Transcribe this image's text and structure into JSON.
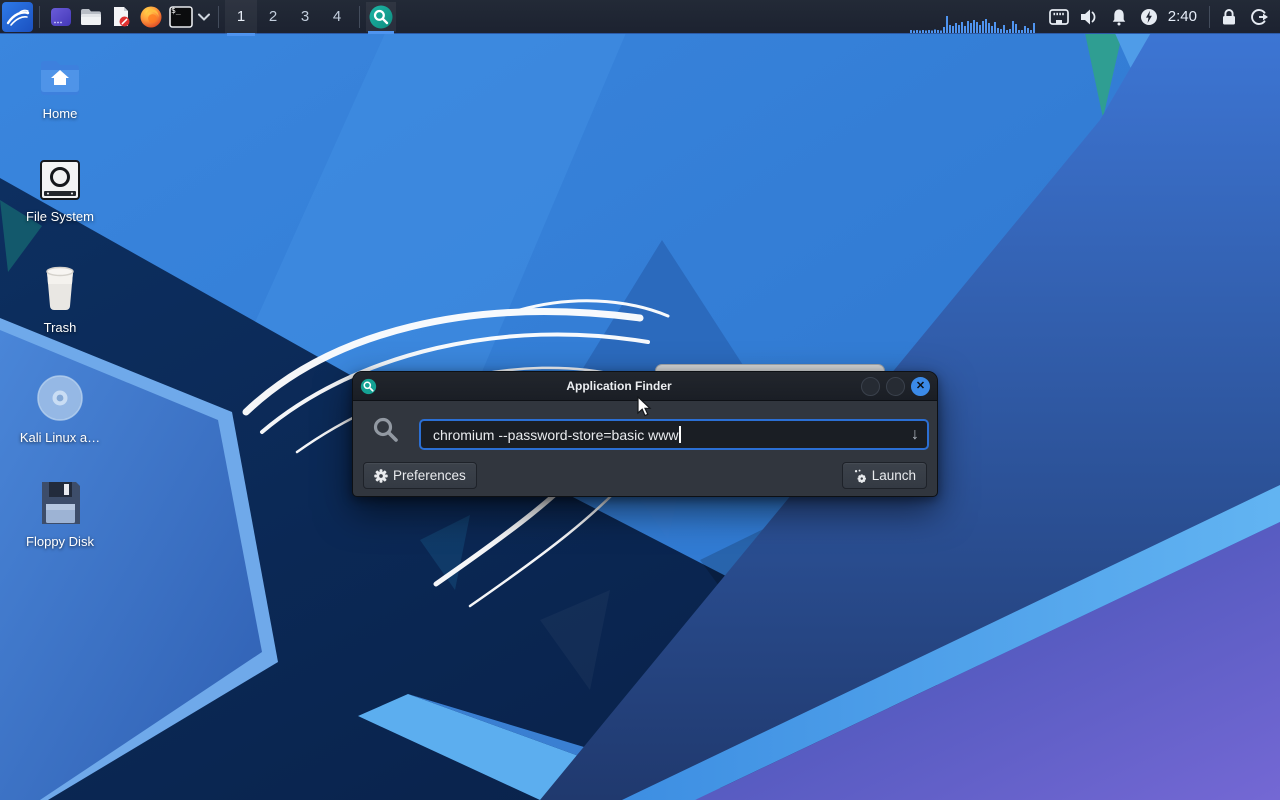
{
  "panel": {
    "workspaces": [
      "1",
      "2",
      "3",
      "4"
    ],
    "clock": "2:40",
    "terminal_glyph": "$_"
  },
  "desktop": {
    "icons": [
      {
        "label": "Home"
      },
      {
        "label": "File System"
      },
      {
        "label": "Trash"
      },
      {
        "label": "Kali Linux a…"
      },
      {
        "label": "Floppy Disk"
      }
    ]
  },
  "finder_window": {
    "title": "Application Finder",
    "close_glyph": "✕",
    "search_value": "chromium --password-store=basic www",
    "dropdown_glyph": "↓",
    "buttons": {
      "preferences": "Preferences",
      "launch": "Launch"
    }
  },
  "colors": {
    "accent_blue": "#4f94ef",
    "panel_bg": "#1c2230",
    "close_button_blue": "#3b8ae8",
    "input_border_blue": "#2b6fd4",
    "finder_icon_teal": "#15a294"
  }
}
